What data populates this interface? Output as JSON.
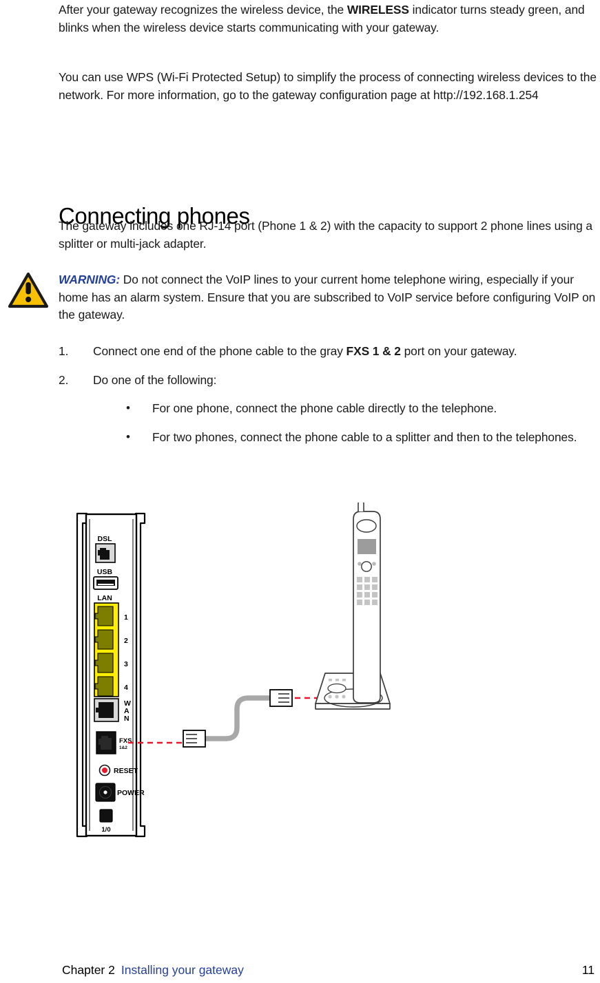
{
  "document": {
    "paragraphs": [
      {
        "id": "wireless-indicator",
        "runs": [
          {
            "text": "After your gateway recognizes the wireless device, the ",
            "bold": false
          },
          {
            "text": "WIRELESS",
            "bold": true
          },
          {
            "text": " indicator turns steady green, and blinks when the wireless device starts communicating with your gateway.",
            "bold": false
          }
        ]
      },
      {
        "id": "wps-info",
        "runs": [
          {
            "text": "You can use WPS (Wi-Fi Protected Setup) to simplify the process of connecting wireless devices to the network. For more information, go to the gateway configuration page at http://192.168.1.254",
            "bold": false
          }
        ]
      }
    ],
    "section": {
      "heading": "Connecting phones",
      "intro": "The gateway includes one RJ-14 port (Phone 1 & 2) with the capacity to support 2 phone lines using a splitter or multi-jack adapter."
    },
    "warning": {
      "icon_name": "warning-triangle-icon",
      "label": "WARNING:",
      "text": " Do not connect the VoIP lines to your current home telephone wiring, especially if your home has an alarm system. Ensure that you are subscribed to VoIP service before configuring VoIP on the gateway.",
      "label_color": "#24409a",
      "triangle_color": "#f7c000",
      "triangle_border": "#1a1a1a"
    },
    "steps": [
      {
        "number": "1.",
        "runs": [
          {
            "text": "Connect one end of the phone cable to the gray ",
            "bold": false
          },
          {
            "text": "FXS 1 & 2",
            "bold": true
          },
          {
            "text": " port on your gateway.",
            "bold": false
          }
        ],
        "bullets": []
      },
      {
        "number": "2.",
        "runs": [
          {
            "text": "Do one of the following:",
            "bold": false
          }
        ],
        "bullets": [
          {
            "marker": "•",
            "text": "For one phone, connect the phone cable directly to the telephone."
          },
          {
            "marker": "•",
            "text": "For two phones, connect the phone cable to a splitter and then to the telephones."
          }
        ]
      }
    ]
  },
  "figure": {
    "name": "gateway-phone-connection-diagram",
    "gateway": {
      "name": "gateway-rear-panel",
      "ports": [
        {
          "id": "dsl",
          "label": "DSL",
          "type": "rj11-gray",
          "sublabel": ""
        },
        {
          "id": "usb",
          "label": "USB",
          "type": "usb-a",
          "sublabel": ""
        },
        {
          "id": "lan",
          "label": "LAN",
          "type": "rj45-yellow-block",
          "sublabel": ""
        },
        {
          "id": "wan",
          "label": "WAN",
          "type": "rj45-gray",
          "sublabel": ""
        },
        {
          "id": "fxs",
          "label": "FXS",
          "type": "rj14-black",
          "sublabel": "1&2"
        },
        {
          "id": "reset",
          "label": "RESET",
          "type": "reset-button",
          "sublabel": ""
        },
        {
          "id": "power",
          "label": "POWER",
          "type": "barrel-jack",
          "sublabel": ""
        },
        {
          "id": "switch",
          "label": "1/0",
          "type": "power-switch",
          "sublabel": ""
        }
      ],
      "lan_port_numbers": [
        "1",
        "2",
        "3",
        "4"
      ],
      "wan_letters": [
        "W",
        "A",
        "N"
      ],
      "colors": {
        "lan_block": "#ffee00",
        "lan_jack": "#8a8a00",
        "gray_port": "#d9d9d9",
        "black_port": "#111111",
        "reset_red": "#e8172b",
        "body": "#ffffff",
        "outline": "#000000"
      }
    },
    "cable": {
      "name": "phone-cable",
      "color": "#a8a8a8",
      "connector_count": 2
    },
    "guide_lines": {
      "name": "red-dashed-guide",
      "color": "#e8172b",
      "count": 2
    },
    "phone": {
      "name": "cordless-telephone",
      "outline": "#3c3c3c",
      "screen_color": "#9c9c9c",
      "key_color": "#c4c4c4"
    }
  },
  "footer": {
    "chapter": "Chapter 2",
    "title": "Installing your gateway",
    "page_number": "11",
    "title_color": "#24409a"
  }
}
